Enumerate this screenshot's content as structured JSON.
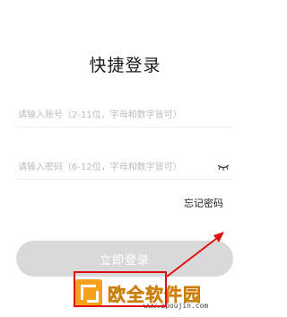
{
  "page": {
    "title": "快捷登录"
  },
  "form": {
    "account_placeholder": "请输入账号（2-11位，字母和数字皆可）",
    "password_placeholder": "请输入密码（6-12位，字母和数字皆可）",
    "password_visibility_icon": "eye-closed-icon",
    "forgot_password_label": "忘记密码",
    "login_button_label": "立即登录"
  },
  "watermark": {
    "brand_text": "欧全软件园",
    "url_text": "www.apoujin.com"
  },
  "colors": {
    "background": "#ffffff",
    "button_bg": "#d9d9d9",
    "button_text": "#ffffff",
    "placeholder": "#bdbdbd",
    "annotation_red": "#e01010",
    "watermark_orange": "#f5a21a"
  }
}
